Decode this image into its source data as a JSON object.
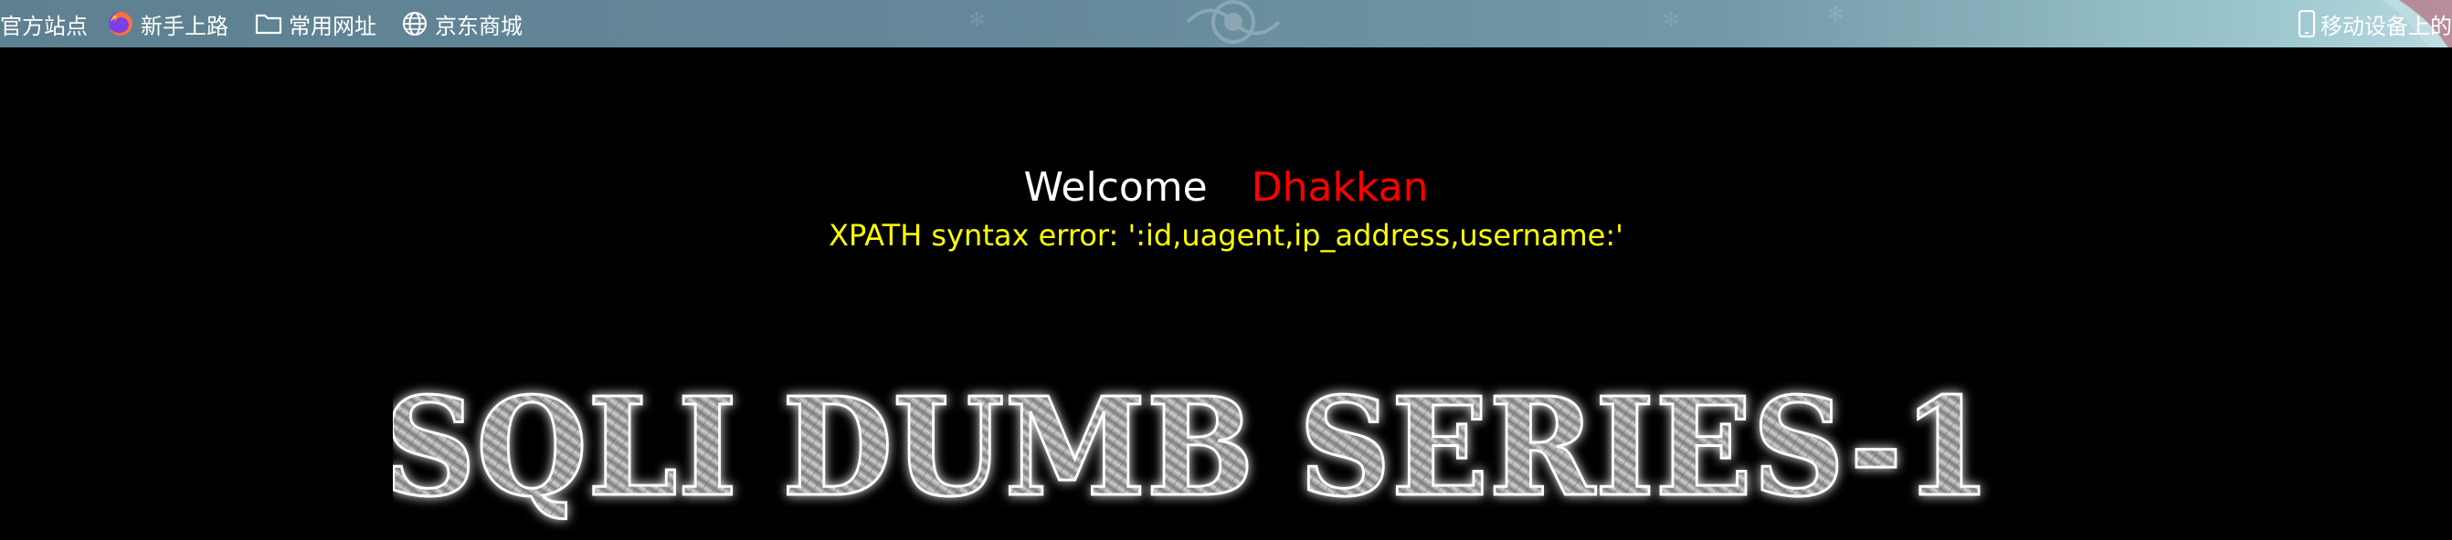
{
  "bookmarks_bar": {
    "items": [
      {
        "label": "官方站点",
        "icon": "page-icon"
      },
      {
        "label": "新手上路",
        "icon": "firefox-icon"
      },
      {
        "label": "常用网址",
        "icon": "folder-icon"
      },
      {
        "label": "京东商城",
        "icon": "globe-icon"
      }
    ],
    "mobile_label": "移动设备上的",
    "mobile_icon": "mobile-device-icon"
  },
  "page": {
    "welcome_text": "Welcome",
    "username": "Dhakkan",
    "error_message": "XPATH syntax error: ':id,uagent,ip_address,username:'",
    "banner_text": "SQLI DUMB SERIES-1"
  },
  "colors": {
    "background": "#000000",
    "welcome": "#ffffff",
    "username": "#ff0000",
    "error": "#ffff00"
  }
}
